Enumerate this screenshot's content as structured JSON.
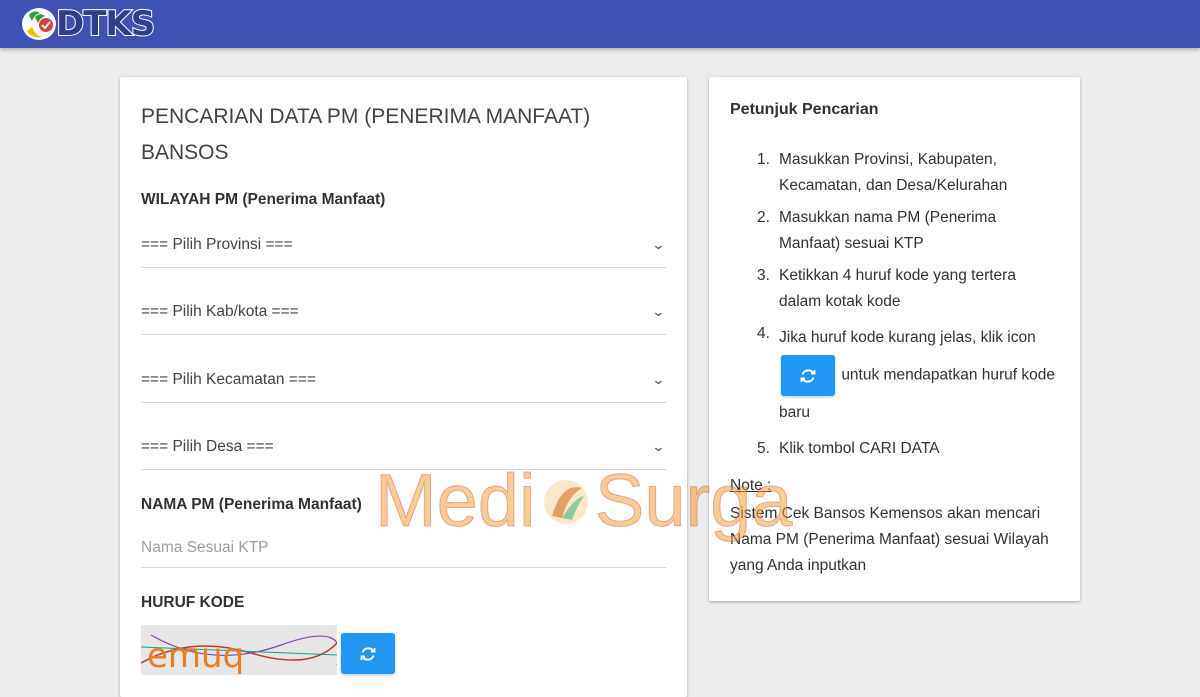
{
  "header": {
    "logo_text": "DTKS",
    "brand_color": "#3f51b5"
  },
  "form": {
    "title": "PENCARIAN DATA PM (PENERIMA MANFAAT) BANSOS",
    "wilayah_label": "WILAYAH PM (Penerima Manfaat)",
    "selects": [
      {
        "value": "=== Pilih Provinsi ==="
      },
      {
        "value": "=== Pilih Kab/kota ==="
      },
      {
        "value": "=== Pilih Kecamatan ==="
      },
      {
        "value": "=== Pilih Desa ==="
      }
    ],
    "nama_label": "NAMA PM (Penerima Manfaat)",
    "nama_placeholder": "Nama Sesuai KTP",
    "kode_label": "HURUF KODE",
    "captcha_text": "emuq",
    "refresh_icon": "refresh-icon",
    "button_color": "#2196f3"
  },
  "guide": {
    "title": "Petunjuk Pencarian",
    "steps": [
      {
        "num": "1.",
        "text": "Masukkan Provinsi, Kabupaten, Kecamatan, dan Desa/Kelurahan"
      },
      {
        "num": "2.",
        "text": "Masukkan nama PM (Penerima Manfaat) sesuai KTP"
      },
      {
        "num": "3.",
        "text": "Ketikkan 4 huruf kode yang tertera dalam kotak kode"
      },
      {
        "num": "4.",
        "text_before": "Jika huruf kode kurang jelas, klik icon",
        "text_after": "untuk mendapatkan huruf kode baru"
      },
      {
        "num": "5.",
        "text": "Klik tombol CARI DATA"
      }
    ],
    "note_label": "Note :",
    "note_text": "Sistem Cek Bansos Kemensos akan mencari Nama PM (Penerima Manfaat) sesuai Wilayah yang Anda inputkan"
  },
  "watermark": {
    "text_left": "Medi",
    "text_right": "Surga"
  }
}
